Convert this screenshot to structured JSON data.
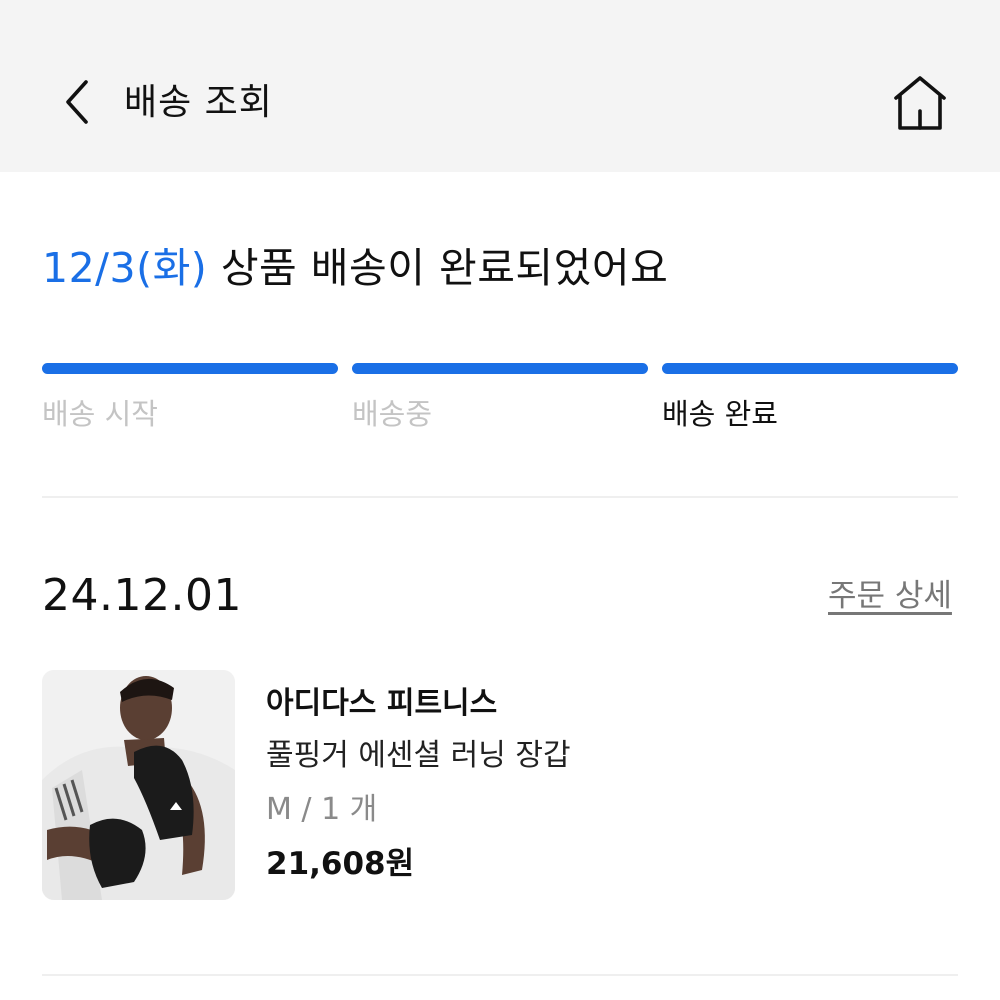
{
  "header": {
    "title": "배송 조회",
    "back_icon": "chevron-left-icon",
    "home_icon": "home-icon"
  },
  "status": {
    "date": "12/3(화)",
    "message": " 상품 배송이 완료되었어요",
    "accent_color": "#1a6fe6"
  },
  "progress": {
    "steps": [
      {
        "label": "배송 시작",
        "state": "done"
      },
      {
        "label": "배송중",
        "state": "done"
      },
      {
        "label": "배송 완료",
        "state": "current"
      }
    ]
  },
  "order": {
    "date": "24.12.01",
    "detail_link": "주문 상세",
    "item": {
      "brand": "아디다스 피트니스",
      "name": "풀핑거 에센셜 러닝 장갑",
      "option": "M / 1 개",
      "price": "21,608원",
      "image": "product-photo"
    }
  }
}
